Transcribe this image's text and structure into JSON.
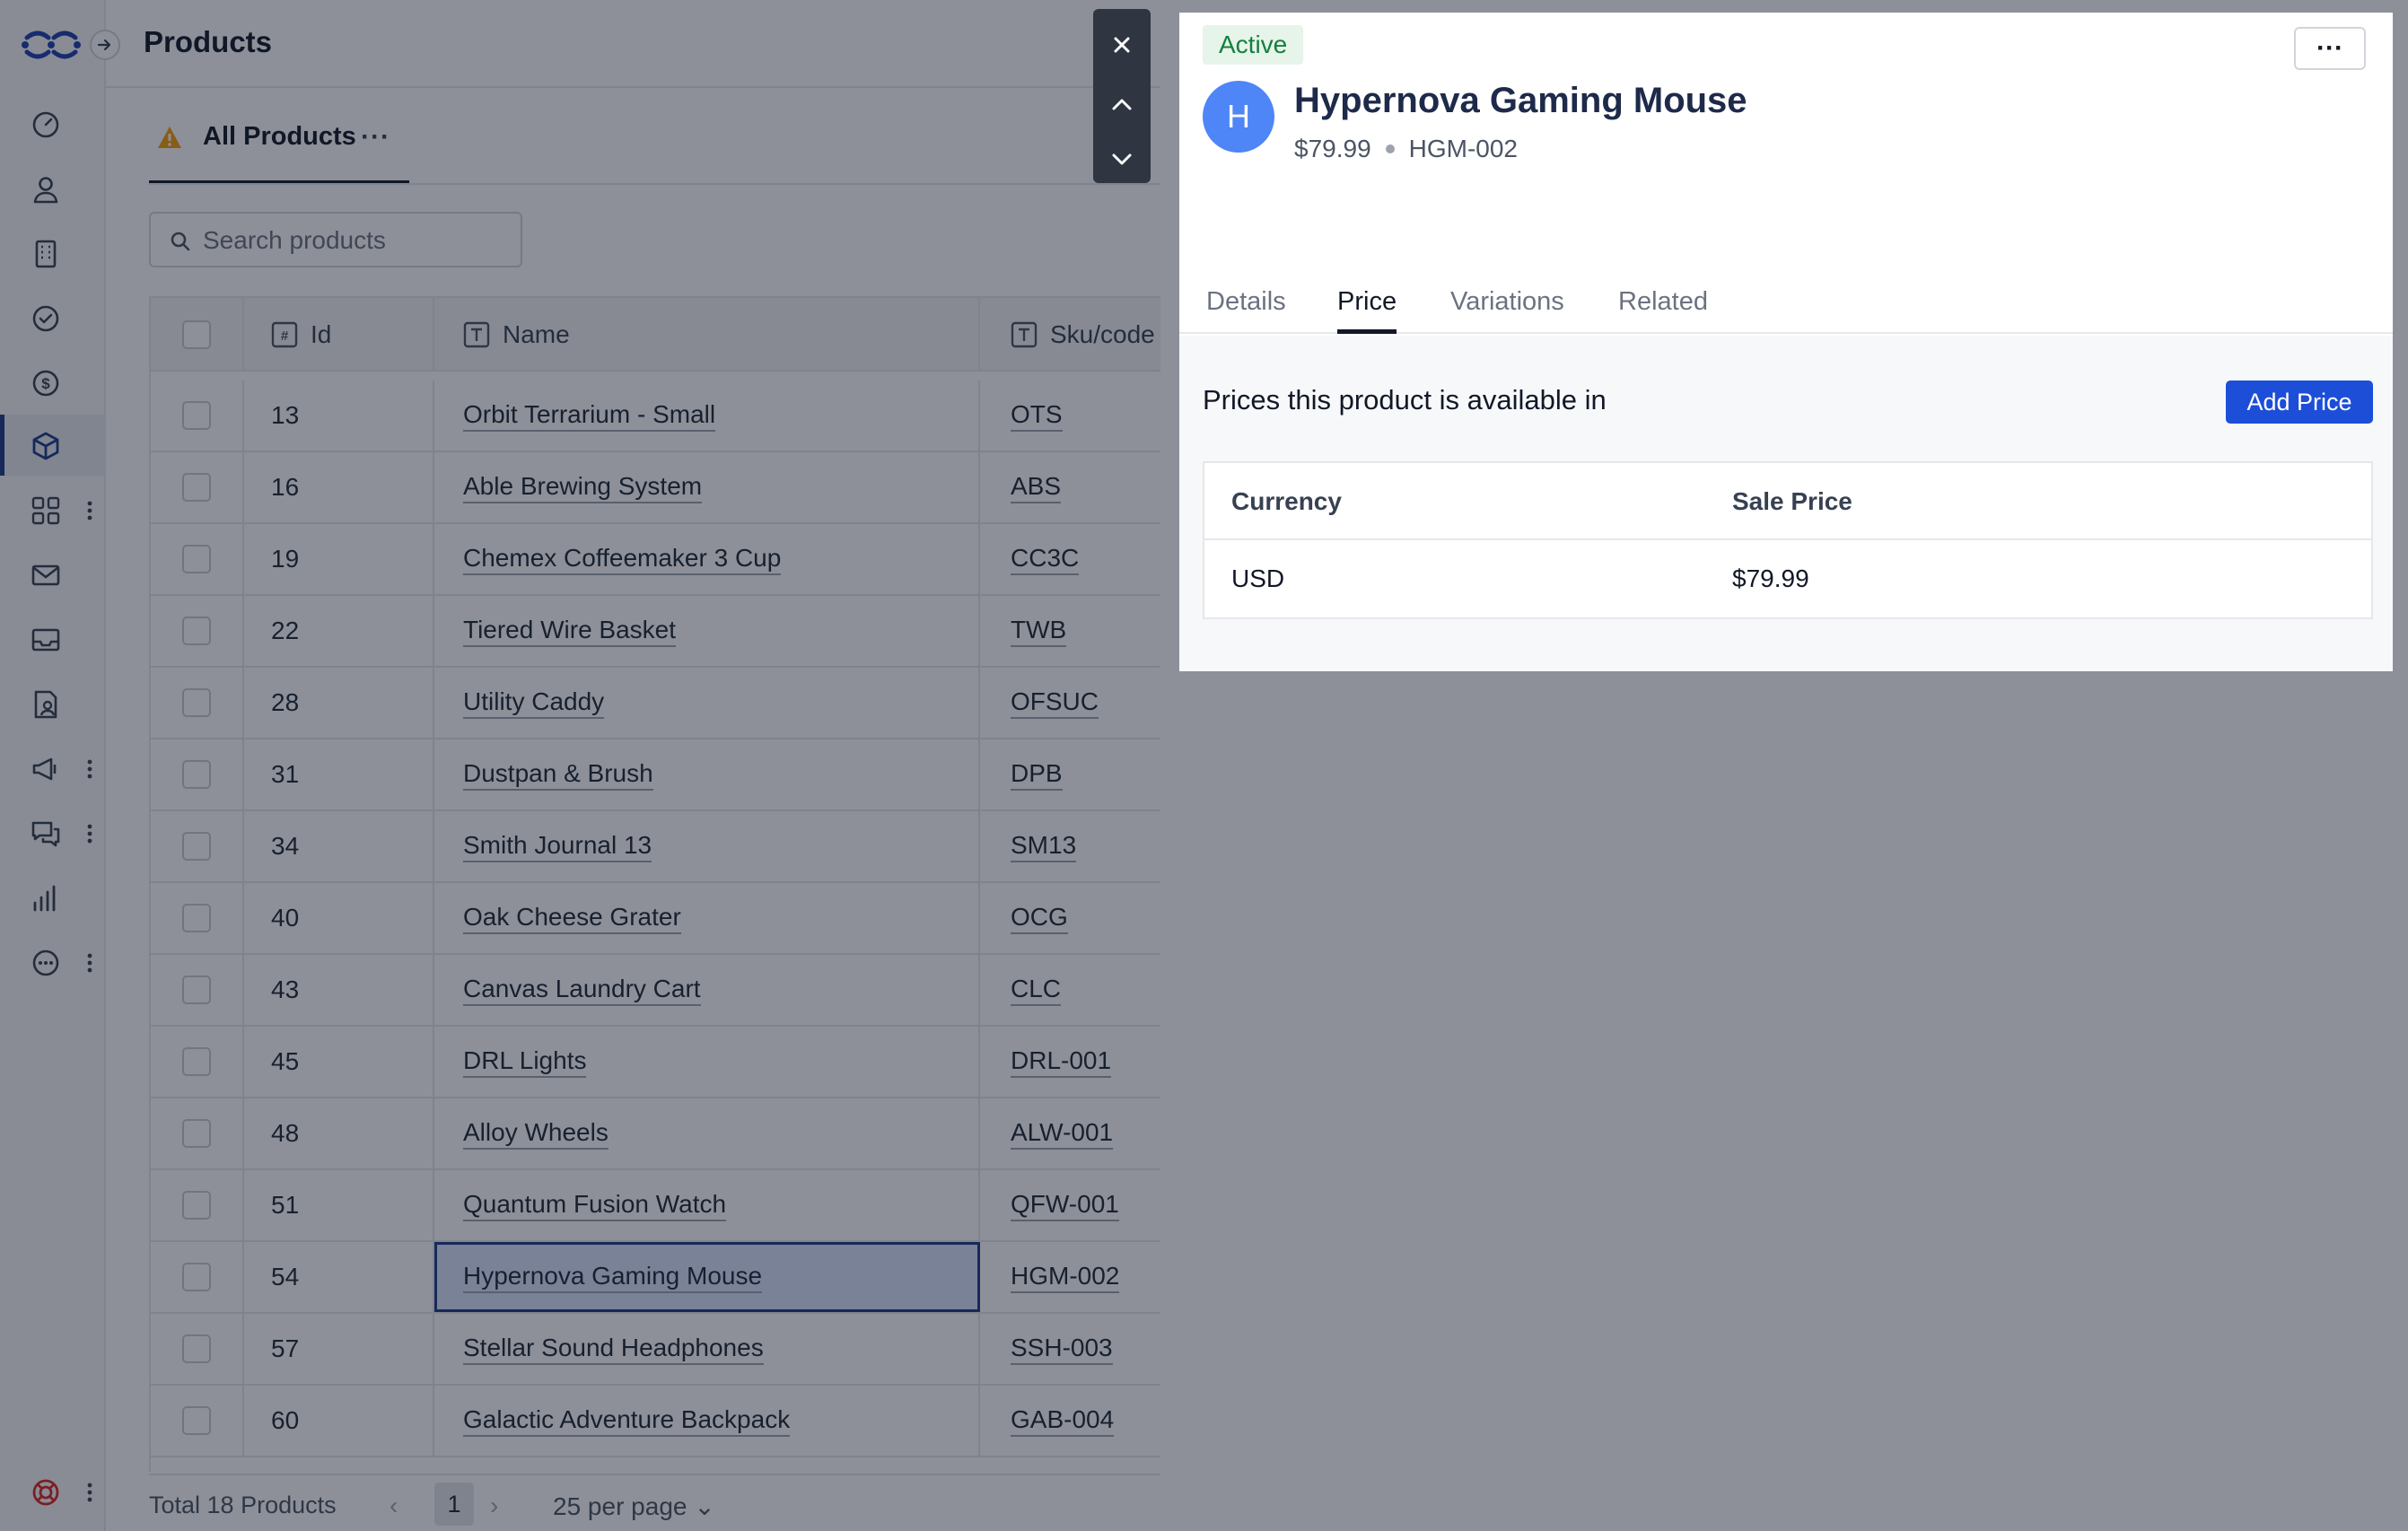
{
  "app": {
    "page_title": "Products"
  },
  "sidebar": {
    "items": [
      {
        "icon": "dashboard-gauge-icon",
        "has_more": false,
        "active": false
      },
      {
        "icon": "person-icon",
        "has_more": false,
        "active": false
      },
      {
        "icon": "building-icon",
        "has_more": false,
        "active": false
      },
      {
        "icon": "check-circle-icon",
        "has_more": false,
        "active": false
      },
      {
        "icon": "dollar-circle-icon",
        "has_more": false,
        "active": false
      },
      {
        "icon": "package-box-icon",
        "has_more": false,
        "active": true
      },
      {
        "icon": "apps-grid-icon",
        "has_more": true,
        "active": false
      },
      {
        "icon": "mail-icon",
        "has_more": false,
        "active": false
      },
      {
        "icon": "inbox-tray-icon",
        "has_more": false,
        "active": false
      },
      {
        "icon": "document-person-icon",
        "has_more": false,
        "active": false
      },
      {
        "icon": "megaphone-icon",
        "has_more": true,
        "active": false
      },
      {
        "icon": "chat-bubbles-icon",
        "has_more": true,
        "active": false
      },
      {
        "icon": "bar-chart-icon",
        "has_more": false,
        "active": false
      },
      {
        "icon": "more-circle-icon",
        "has_more": true,
        "active": false
      }
    ],
    "bottom_icon": "lifebuoy-icon"
  },
  "view": {
    "tab_label": "All Products",
    "tab_more": "···",
    "search_placeholder": "Search products"
  },
  "table": {
    "columns": {
      "id": "Id",
      "name": "Name",
      "sku": "Sku/code"
    },
    "rows": [
      {
        "id": "13",
        "name": "Orbit Terrarium - Small",
        "sku": "OTS"
      },
      {
        "id": "16",
        "name": "Able Brewing System",
        "sku": "ABS"
      },
      {
        "id": "19",
        "name": "Chemex Coffeemaker 3 Cup",
        "sku": "CC3C"
      },
      {
        "id": "22",
        "name": "Tiered Wire Basket",
        "sku": "TWB"
      },
      {
        "id": "28",
        "name": "Utility Caddy",
        "sku": "OFSUC"
      },
      {
        "id": "31",
        "name": "Dustpan & Brush",
        "sku": "DPB"
      },
      {
        "id": "34",
        "name": "Smith Journal 13",
        "sku": "SM13"
      },
      {
        "id": "40",
        "name": "Oak Cheese Grater",
        "sku": "OCG"
      },
      {
        "id": "43",
        "name": "Canvas Laundry Cart",
        "sku": "CLC"
      },
      {
        "id": "45",
        "name": "DRL Lights",
        "sku": "DRL-001"
      },
      {
        "id": "48",
        "name": "Alloy Wheels",
        "sku": "ALW-001"
      },
      {
        "id": "51",
        "name": "Quantum Fusion Watch",
        "sku": "QFW-001"
      },
      {
        "id": "54",
        "name": "Hypernova Gaming Mouse",
        "sku": "HGM-002",
        "selected": true
      },
      {
        "id": "57",
        "name": "Stellar Sound Headphones",
        "sku": "SSH-003"
      },
      {
        "id": "60",
        "name": "Galactic Adventure Backpack",
        "sku": "GAB-004"
      }
    ]
  },
  "footer": {
    "total": "Total 18 Products",
    "page": "1",
    "per_page": "25 per page"
  },
  "detail": {
    "status": "Active",
    "more": "···",
    "avatar_letter": "H",
    "name": "Hypernova Gaming Mouse",
    "price": "$79.99",
    "sku": "HGM-002",
    "tabs": [
      "Details",
      "Price",
      "Variations",
      "Related"
    ],
    "active_tab": "Price",
    "prices_title": "Prices this product is available in",
    "add_price_label": "Add Price",
    "price_table": {
      "headers": {
        "currency": "Currency",
        "sale_price": "Sale Price"
      },
      "rows": [
        {
          "currency": "USD",
          "sale_price": "$79.99"
        }
      ]
    }
  },
  "colors": {
    "accent": "#1d4ed8",
    "status_green": "#15803d",
    "avatar": "#4f86f7",
    "rail_active": "#1e3a8a"
  }
}
